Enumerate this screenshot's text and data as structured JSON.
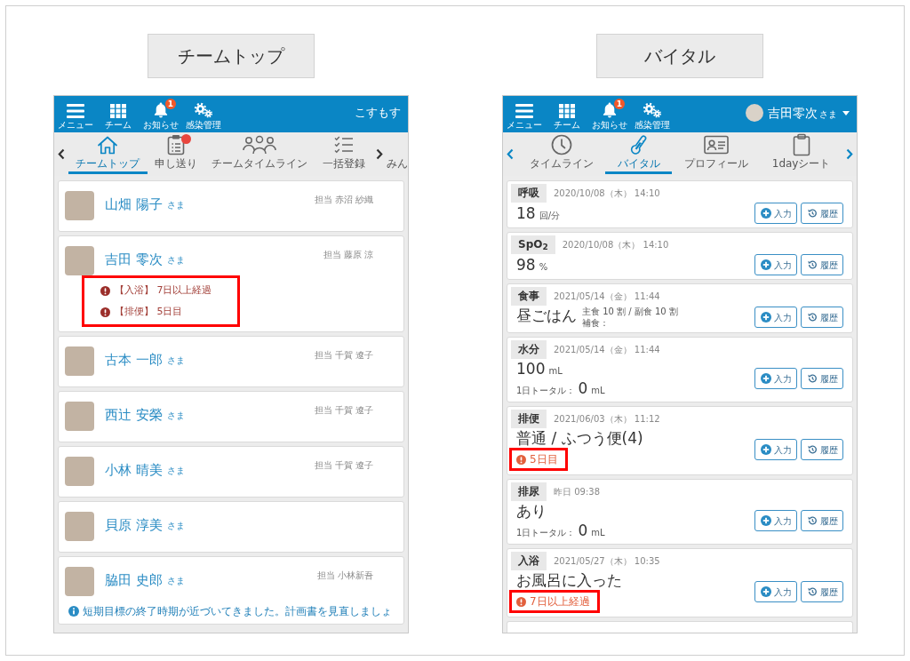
{
  "panels": [
    {
      "kind": "team_top",
      "caption": "チームトップ",
      "header": {
        "items": [
          {
            "kind": "menu",
            "label": "メニュー"
          },
          {
            "kind": "team",
            "label": "チーム"
          },
          {
            "kind": "notices",
            "label": "お知らせ",
            "badge": "1"
          },
          {
            "kind": "infection",
            "label": "感染管理"
          }
        ],
        "account": {
          "name": "こすもす"
        }
      },
      "nav": {
        "arrows_accent": false,
        "tabs": [
          {
            "kind": "home",
            "label": "チームトップ",
            "selected": true,
            "dot": false
          },
          {
            "kind": "handover",
            "label": "申し送り",
            "selected": false,
            "dot": true
          },
          {
            "kind": "team_timeline",
            "label": "チームタイムライン",
            "selected": false,
            "dot": false
          },
          {
            "kind": "bulk",
            "label": "一括登録",
            "selected": false,
            "dot": false
          }
        ],
        "overflow_tab": "みん"
      },
      "residents": [
        {
          "name": "山畑 陽子",
          "honorific": "さま",
          "staff": "担当 赤沼 紗織"
        },
        {
          "name": "吉田 零次",
          "honorific": "さま",
          "staff": "担当 藤原 涼",
          "alerts_highlighted": true,
          "alerts": [
            "【入浴】 7日以上経過",
            "【排便】 5日目"
          ]
        },
        {
          "name": "古本 一郎",
          "honorific": "さま",
          "staff": "担当 千賀 遼子"
        },
        {
          "name": "西辻 安榮",
          "honorific": "さま",
          "staff": "担当 千賀 遼子"
        },
        {
          "name": "小林 晴美",
          "honorific": "さま",
          "staff": "担当 千賀 遼子"
        },
        {
          "name": "貝原 淳美",
          "honorific": "さま"
        },
        {
          "name": "脇田 史郎",
          "honorific": "さま",
          "staff": "担当 小林新吾",
          "notice": "短期目標の終了時期が近づいてきました。計画書を見直しましょ"
        }
      ]
    },
    {
      "kind": "vital",
      "caption": "バイタル",
      "header": {
        "items": [
          {
            "kind": "menu",
            "label": "メニュー"
          },
          {
            "kind": "team",
            "label": "チーム"
          },
          {
            "kind": "notices",
            "label": "お知らせ",
            "badge": "1"
          },
          {
            "kind": "infection",
            "label": "感染管理"
          }
        ],
        "account": {
          "name": "吉田零次",
          "honorific": "さま",
          "avatar": true,
          "dropdown": true
        }
      },
      "nav": {
        "arrows_accent": true,
        "tabs": [
          {
            "kind": "timeline",
            "label": "タイムライン",
            "selected": false,
            "dot": false
          },
          {
            "kind": "vital",
            "label": "バイタル",
            "selected": true,
            "dot": false
          },
          {
            "kind": "profile",
            "label": "プロフィール",
            "selected": false,
            "dot": false
          },
          {
            "kind": "sheet",
            "label": "1dayシート",
            "selected": false,
            "dot": false
          }
        ]
      },
      "records": [
        {
          "kind": "measure",
          "label": "呼吸",
          "time": "2020/10/08（木） 14:10",
          "value": "18",
          "unit": "回/分",
          "buttons": [
            {
              "kind": "input",
              "label": "入力"
            },
            {
              "kind": "history",
              "label": "履歴"
            }
          ]
        },
        {
          "kind": "measure",
          "label": "SpO$_{2}$",
          "time": "2020/10/08（木） 14:10",
          "value": "98",
          "unit": "%",
          "buttons": [
            {
              "kind": "input",
              "label": "入力"
            },
            {
              "kind": "history",
              "label": "履歴"
            }
          ]
        },
        {
          "kind": "meal",
          "label": "食事",
          "time": "2021/05/14（金） 11:44",
          "value": "昼ごはん",
          "details": [
            "主食 10 割 / 副食 10 割",
            "補食："
          ],
          "buttons": [
            {
              "kind": "input",
              "label": "入力"
            },
            {
              "kind": "history",
              "label": "履歴"
            }
          ]
        },
        {
          "kind": "measure",
          "label": "水分",
          "time": "2021/05/14（金） 11:44",
          "value": "100",
          "unit": "mL",
          "total": {
            "label": "1日トータル：",
            "value": "0",
            "unit": "mL"
          },
          "buttons": [
            {
              "kind": "input",
              "label": "入力"
            },
            {
              "kind": "history",
              "label": "履歴"
            }
          ]
        },
        {
          "kind": "text",
          "label": "排便",
          "time": "2021/06/03（木） 11:12",
          "value": "普通 / ふつう便(4)",
          "alert": {
            "text": "5日目",
            "highlighted": true
          },
          "buttons": [
            {
              "kind": "input",
              "label": "入力"
            },
            {
              "kind": "history",
              "label": "履歴"
            }
          ]
        },
        {
          "kind": "text",
          "label": "排尿",
          "time": "昨日 09:38",
          "value": "あり",
          "total": {
            "label": "1日トータル：",
            "value": "0",
            "unit": "mL"
          },
          "buttons": [
            {
              "kind": "input",
              "label": "入力"
            },
            {
              "kind": "history",
              "label": "履歴"
            }
          ]
        },
        {
          "kind": "text",
          "label": "入浴",
          "time": "2021/05/27（木） 10:35",
          "value": "お風呂に入った",
          "alert": {
            "text": "7日以上経過",
            "highlighted": true
          },
          "buttons": [
            {
              "kind": "input",
              "label": "入力"
            },
            {
              "kind": "history",
              "label": "履歴"
            }
          ]
        }
      ]
    }
  ]
}
